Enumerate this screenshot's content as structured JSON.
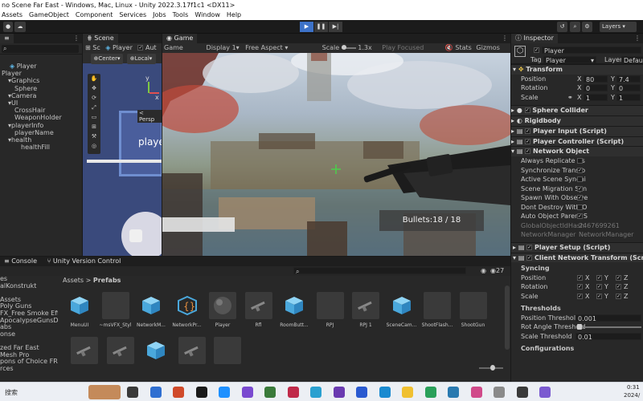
{
  "window": {
    "title": "no Scene Far East - Windows, Mac, Linux - Unity 2022.3.17f1c1 <DX11>"
  },
  "menu": [
    "Assets",
    "GameObject",
    "Component",
    "Services",
    "Jobs",
    "Tools",
    "Window",
    "Help"
  ],
  "toolbar": {
    "layers": "Layers",
    "layout": "Default"
  },
  "hierarchy": {
    "root": "Player",
    "items": [
      {
        "label": "Player",
        "indent": 0,
        "arrow": false
      },
      {
        "label": "Graphics",
        "indent": 1,
        "arrow": true
      },
      {
        "label": "Sphere",
        "indent": 2,
        "arrow": false
      },
      {
        "label": "Camera",
        "indent": 1,
        "arrow": true
      },
      {
        "label": "UI",
        "indent": 1,
        "arrow": true
      },
      {
        "label": "CrossHair",
        "indent": 2,
        "arrow": false
      },
      {
        "label": "WeaponHolder",
        "indent": 2,
        "arrow": false
      },
      {
        "label": "playerInfo",
        "indent": 1,
        "arrow": true
      },
      {
        "label": "playerName",
        "indent": 2,
        "arrow": false
      },
      {
        "label": "health",
        "indent": 1,
        "arrow": true
      },
      {
        "label": "healthFill",
        "indent": 3,
        "arrow": false
      }
    ]
  },
  "scene": {
    "tab": "Scene",
    "subtab": "Sc",
    "object": "Player",
    "auto": "Aut",
    "pivot": "Center",
    "space": "Local",
    "persp": "< Persp",
    "axis_y": "y",
    "axis_x": "x",
    "player_text": "player"
  },
  "game": {
    "tab": "Game",
    "mode": "Game",
    "display": "Display 1",
    "aspect": "Free Aspect",
    "scale_label": "Scale",
    "scale_value": "1.3x",
    "play_focused": "Play Focused",
    "stats": "Stats",
    "gizmos": "Gizmos",
    "bullets": "Bullets:18 / 18"
  },
  "inspector": {
    "tab": "Inspector",
    "object_name": "Player",
    "tag_label": "Tag",
    "tag_value": "Player",
    "layer_label": "Layer",
    "layer_value": "Default",
    "transform": {
      "title": "Transform",
      "position_label": "Position",
      "rotation_label": "Rotation",
      "scale_label": "Scale",
      "px": "80",
      "py": "7.4",
      "rx": "0",
      "ry": "0",
      "sx": "1",
      "sy": "1",
      "x": "X",
      "y": "Y"
    },
    "components": [
      {
        "name": "Sphere Collider",
        "checked": true
      },
      {
        "name": "Rigidbody",
        "checked": false
      },
      {
        "name": "Player Input (Script)",
        "checked": true
      },
      {
        "name": "Player Controller (Script)",
        "checked": true
      },
      {
        "name": "Network Object",
        "checked": true
      }
    ],
    "network_rows": [
      {
        "label": "Always Replicate As",
        "check": false
      },
      {
        "label": "Synchronize Transfo",
        "check": true
      },
      {
        "label": "Active Scene Synchi",
        "check": false
      },
      {
        "label": "Scene Migration Syn",
        "check": true
      },
      {
        "label": "Spawn With Observe",
        "check": true
      },
      {
        "label": "Dont Destroy With O",
        "check": false
      },
      {
        "label": "Auto Object Parent S",
        "check": true
      }
    ],
    "global_hash_label": "GlobalObjectIdHash",
    "global_hash_value": "2467699261",
    "network_manager_label": "NetworkManager",
    "network_manager_value": "NetworkManager",
    "player_setup": "Player Setup (Script)",
    "client_transform": "Client Network Transform (Script)",
    "syncing": "Syncing",
    "sync_rows": [
      "Position",
      "Rotation",
      "Scale"
    ],
    "thresholds": "Thresholds",
    "position_threshold_label": "Position Threshold",
    "position_threshold_value": "0.001",
    "rot_threshold_label": "Rot Angle Threshold",
    "scale_threshold_label": "Scale Threshold",
    "scale_threshold_value": "0.01",
    "configurations": "Configurations"
  },
  "bottom": {
    "console_tab": "Console",
    "vcs_tab": "Unity Version Control",
    "count": "27",
    "breadcrumb_root": "Assets",
    "breadcrumb_sep": ">",
    "breadcrumb_leaf": "Prefabs",
    "categories": [
      "es",
      "alKonstrukt",
      "",
      "Assets",
      "Poly Guns",
      "FX_Free Smoke Effec",
      "ApocalypseGunsDen",
      "abs",
      "onse",
      "",
      "zed Far East",
      "Mesh Pro",
      "pons of Choice FREE",
      "rces"
    ],
    "assets": [
      {
        "label": "MenuUI",
        "kind": "cube"
      },
      {
        "label": "~msVFX_Styl",
        "kind": "blank"
      },
      {
        "label": "NetworkM...",
        "kind": "cube"
      },
      {
        "label": "NetworkPr...",
        "kind": "script"
      },
      {
        "label": "Player",
        "kind": "sphere"
      },
      {
        "label": "Rfl",
        "kind": "gun"
      },
      {
        "label": "RoomButt...",
        "kind": "cube"
      },
      {
        "label": "RPJ",
        "kind": "blank"
      },
      {
        "label": "RPJ 1",
        "kind": "gun"
      },
      {
        "label": "SceneCam...",
        "kind": "cube"
      },
      {
        "label": "ShootFlash...",
        "kind": "blank"
      },
      {
        "label": "ShootGun",
        "kind": "blank"
      }
    ],
    "assets_row2": [
      {
        "kind": "gun"
      },
      {
        "kind": "gun"
      },
      {
        "kind": "cube"
      },
      {
        "kind": "gun"
      },
      {
        "kind": "blank"
      }
    ]
  },
  "taskbar": {
    "left_text": "搜索",
    "time": "0:31",
    "date": "2024/"
  },
  "colors": {
    "accent": "#3d72c8",
    "cube": "#5fb8e8",
    "panel": "#282828"
  }
}
